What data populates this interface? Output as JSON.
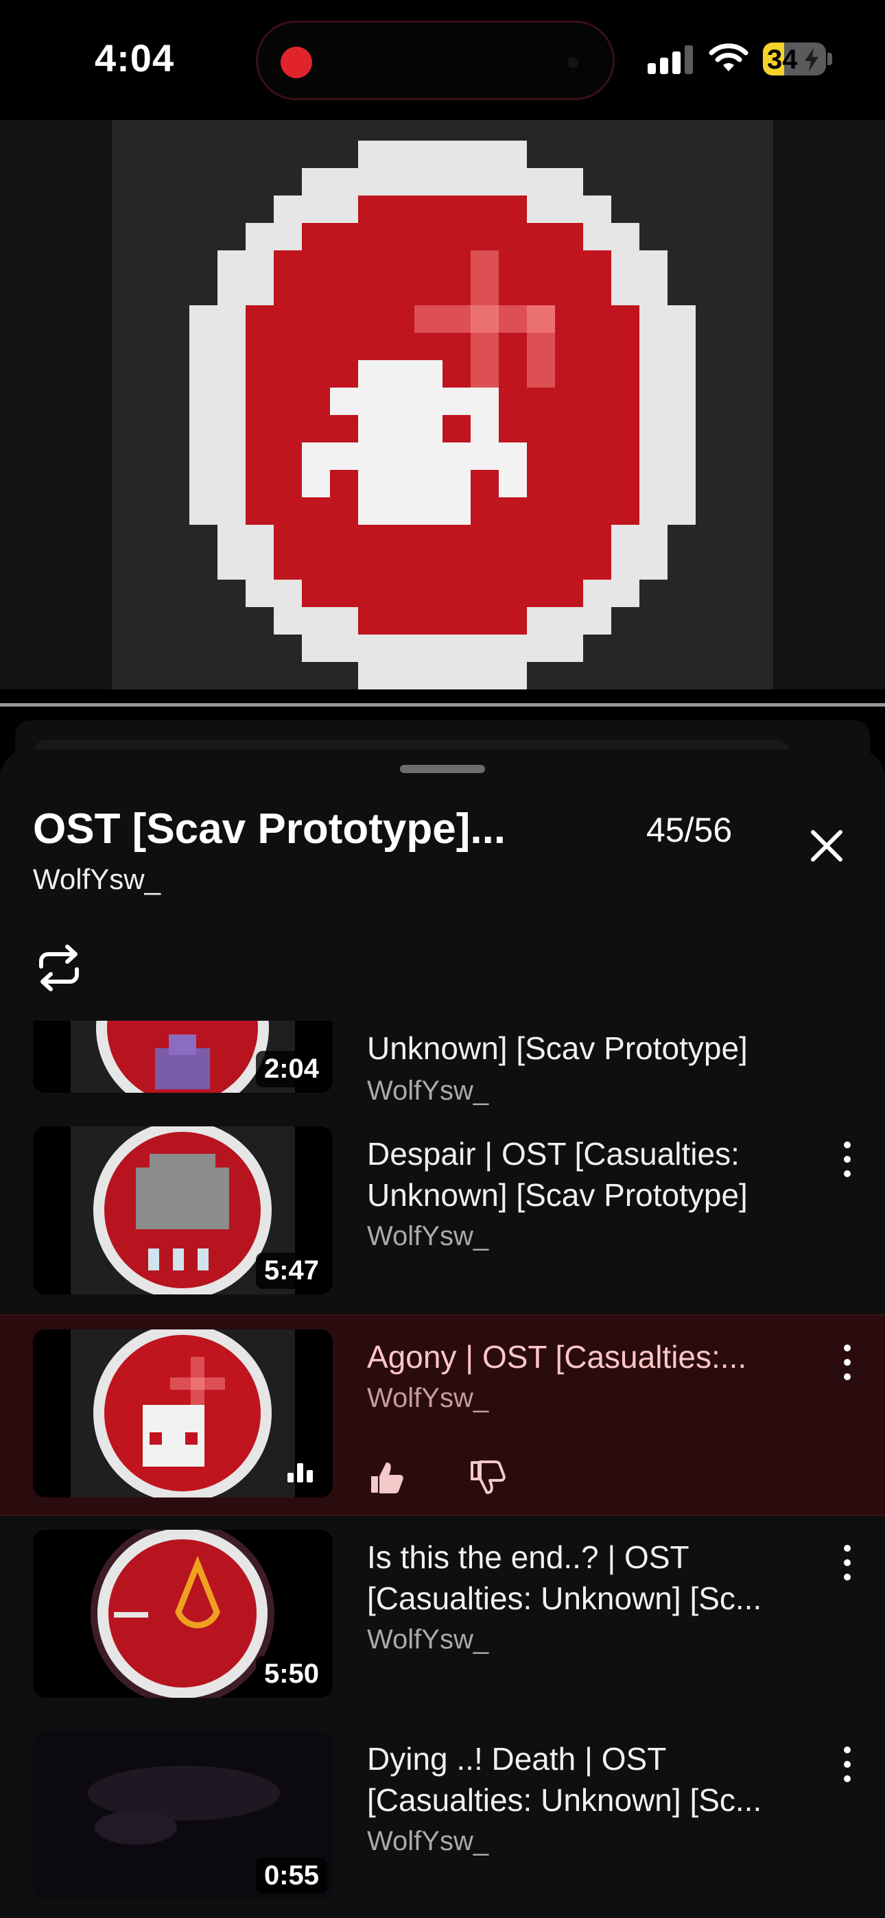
{
  "status_bar": {
    "time": "4:04",
    "battery_level": "34",
    "battery_percent": 34,
    "recording_indicator": "red-dot",
    "icons": [
      "signal-icon",
      "wifi-icon",
      "battery-charging-icon"
    ]
  },
  "video": {
    "art": "pixel-red-badge-skull-cross"
  },
  "playlist": {
    "title": "OST [Scav Prototype]...",
    "owner": "WolfYsw_",
    "position": "45/56",
    "close_icon": "close-icon",
    "loop_icon": "loop-icon"
  },
  "items": [
    {
      "title_line2": "Unknown] [Scav Prototype]",
      "channel": "WolfYsw_",
      "duration": "2:04"
    },
    {
      "title": "Despair | OST [Casualties: Unknown] [Scav Prototype]",
      "channel": "WolfYsw_",
      "duration": "5:47"
    },
    {
      "title": "Agony | OST [Casualties:...",
      "channel": "WolfYsw_",
      "now_playing": true,
      "like_icon": "thumbs-up-icon",
      "dislike_icon": "thumbs-down-icon"
    },
    {
      "title": "Is this the end..? | OST [Casualties: Unknown] [Sc...",
      "channel": "WolfYsw_",
      "duration": "5:50"
    },
    {
      "title": "Dying ..! Death | OST [Casualties: Unknown] [Sc...",
      "channel": "WolfYsw_",
      "duration": "0:55"
    }
  ],
  "colors": {
    "background": "#0f0f0f",
    "active_row": "#2a0b0e",
    "badge_red": "#c0141e",
    "badge_white": "#e8e8e8",
    "battery": "#f4d229"
  }
}
